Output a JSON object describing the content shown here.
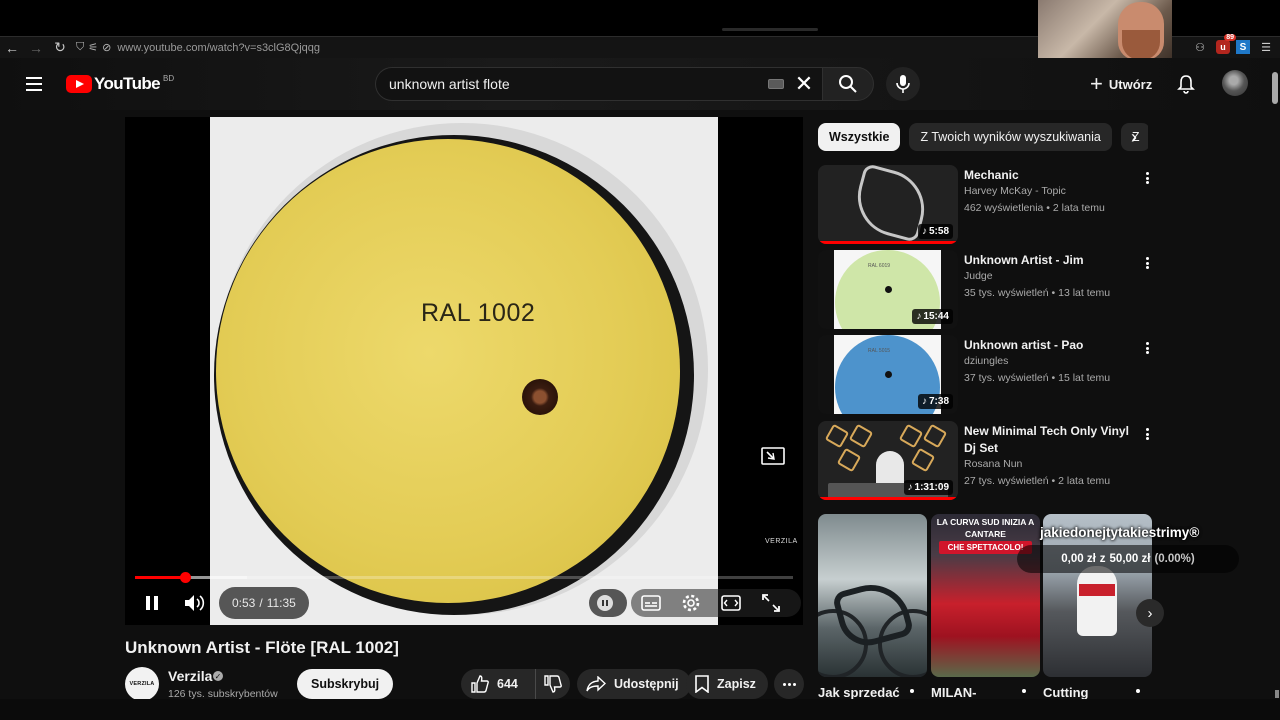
{
  "browser": {
    "url": "www.youtube.com/watch?v=s3clG8Qjqqg",
    "extension_badge": "89",
    "ext_s_label": "S"
  },
  "header": {
    "logo_text": "YouTube",
    "country_code": "BD",
    "search_value": "unknown artist flote",
    "create_label": "Utwórz"
  },
  "player": {
    "album_label": "RAL 1002",
    "watermark": "VERZILA",
    "current_time": "0:53",
    "separator": "/",
    "duration": "11:35",
    "progress_fraction": 0.076,
    "buffer_fraction": 0.17
  },
  "video": {
    "title": "Unknown Artist - Flöte [RAL 1002]",
    "channel": "Verzila",
    "channel_avatar_text": "VERZILA",
    "subscribers": "126 tys. subskrybentów",
    "subscribe_label": "Subskrybuj",
    "likes": "644",
    "share_label": "Udostępnij",
    "save_label": "Zapisz"
  },
  "chips": [
    {
      "label": "Wszystkie",
      "active": true
    },
    {
      "label": "Z Twoich wyników wyszukiwania",
      "active": false
    },
    {
      "label": "Z",
      "active": false
    }
  ],
  "recommendations": [
    {
      "title": "Mechanic",
      "channel": "Harvey McKay - Topic",
      "stats": "462 wyświetlenia • 2 lata temu",
      "duration": "5:58",
      "watched": true
    },
    {
      "title": "Unknown Artist - Jim",
      "channel": "Judge",
      "stats": "35 tys. wyświetleń • 13 lat temu",
      "duration": "15:44",
      "label_text": "RAL 6019",
      "watched": false
    },
    {
      "title": "Unknown artist - Pao",
      "channel": "dziungles",
      "stats": "37 tys. wyświetleń • 15 lat temu",
      "duration": "7:38",
      "label_text": "RAL 5015",
      "watched": false
    },
    {
      "title": "New Minimal Tech Only Vinyl Dj Set",
      "channel": "Rosana Nun",
      "stats": "27 tys. wyświetleń • 2 lata temu",
      "duration": "1:31:09",
      "watched": true
    }
  ],
  "shorts": [
    {
      "title": "Jak sprzedać"
    },
    {
      "title": "MILAN-",
      "overlay_top": "LA CURVA SUD INIZIA A CANTARE",
      "overlay_bottom": "CHE SPETTACOLO!"
    },
    {
      "title": "Cutting"
    }
  ],
  "stream_overlay": {
    "handle": "jakiedonejtytakiestrimy®",
    "raised": "0,00 zł",
    "divider": "z",
    "goal": "50,00 zł",
    "percent": "(0.00%)"
  },
  "colors": {
    "accent": "#ff0000",
    "background": "#0f0f0f",
    "vinyl_label": "#e3cc55",
    "thumb_jim": "#cfe6a8",
    "thumb_pao": "#4d93cc"
  }
}
